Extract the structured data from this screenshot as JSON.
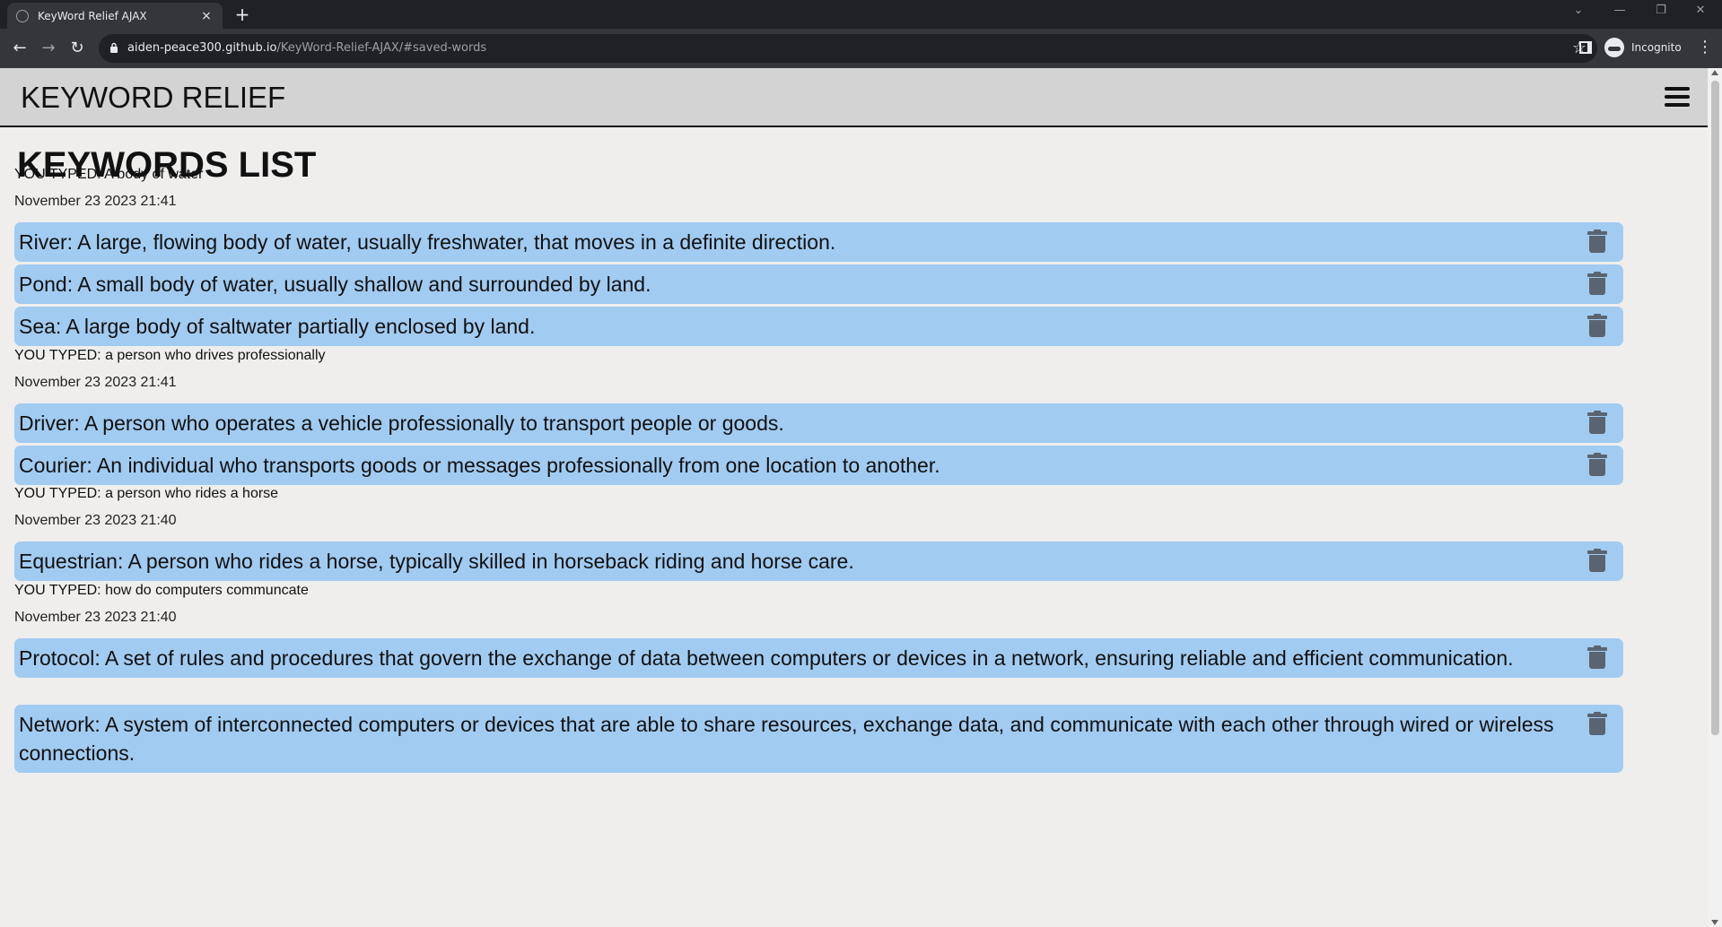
{
  "browser": {
    "tab_title": "KeyWord Relief AJAX",
    "tab_close": "×",
    "new_tab": "+",
    "url_host": "aiden-peace300.github.io",
    "url_path": "/KeyWord-Relief-AJAX/#saved-words",
    "incognito_label": "Incognito"
  },
  "site": {
    "title": "KEYWORD RELIEF",
    "heading": "KEYWORDS LIST"
  },
  "groups": [
    {
      "typed": "YOU TYPED: A body of water",
      "date": "November 23 2023 21:41",
      "entries": [
        "River: A large, flowing body of water, usually freshwater, that moves in a definite direction.",
        "Pond: A small body of water, usually shallow and surrounded by land.",
        "Sea: A large body of saltwater partially enclosed by land."
      ]
    },
    {
      "typed": "YOU TYPED: a person who drives professionally",
      "date": "November 23 2023 21:41",
      "entries": [
        "Driver: A person who operates a vehicle professionally to transport people or goods.",
        "Courier: An individual who transports goods or messages professionally from one location to another."
      ]
    },
    {
      "typed": "YOU TYPED: a person who rides a horse",
      "date": "November 23 2023 21:40",
      "entries": [
        "Equestrian: A person who rides a horse, typically skilled in horseback riding and horse care."
      ]
    },
    {
      "typed": "YOU TYPED: how do computers communcate",
      "date": "November 23 2023 21:40",
      "entries": [
        "Protocol: A set of rules and procedures that govern the exchange of data between computers or devices in a network, ensuring reliable and efficient communication.",
        "Network: A system of interconnected computers or devices that are able to share resources, exchange data, and communicate with each other through wired or wireless connections."
      ]
    }
  ]
}
